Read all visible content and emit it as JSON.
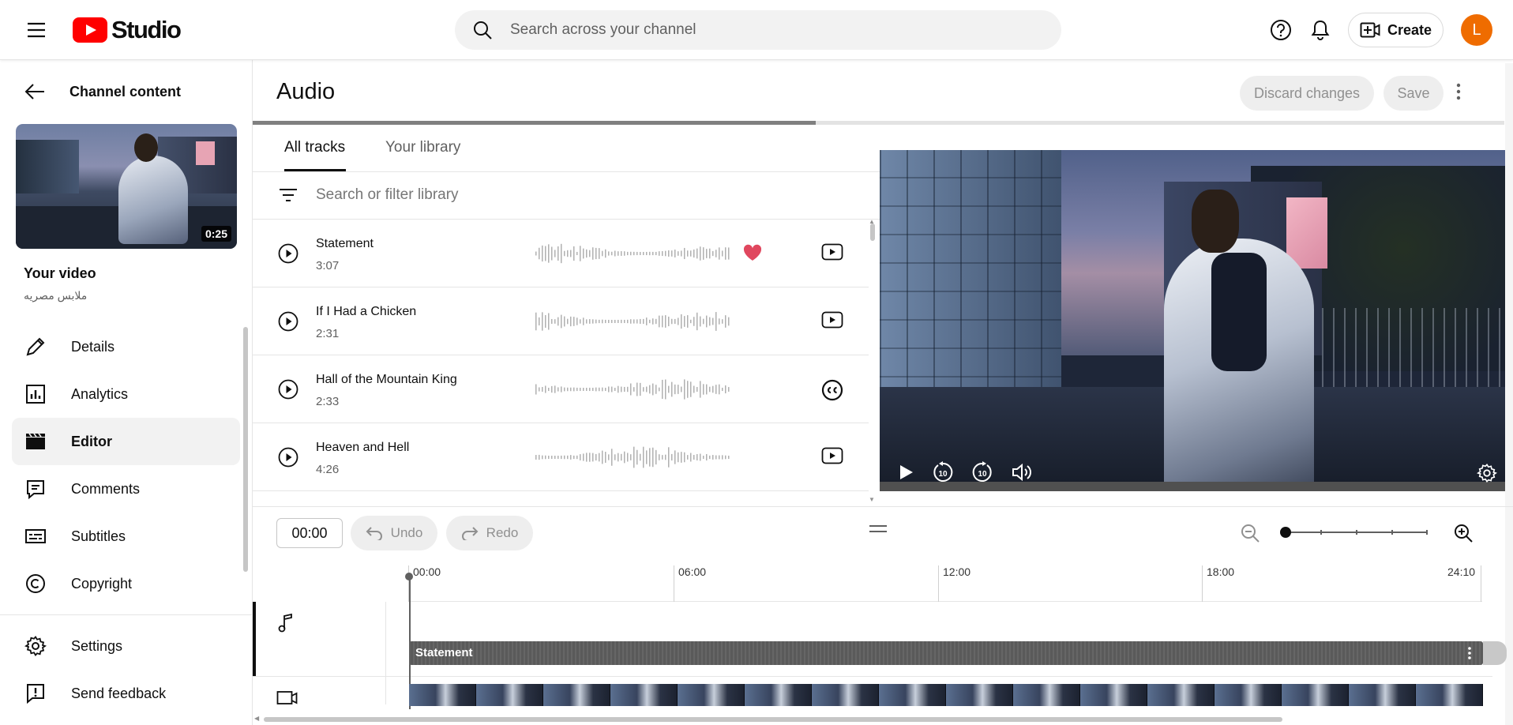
{
  "app": {
    "logo_text": "Studio",
    "brand_color": "#ff0000"
  },
  "search": {
    "placeholder": "Search across your channel"
  },
  "header": {
    "create_label": "Create",
    "avatar_initial": "L",
    "avatar_color": "#ef6c00"
  },
  "sidebar": {
    "back_label": "Channel content",
    "thumbnail_duration": "0:25",
    "your_video_label": "Your video",
    "video_title": "ملابس مصريه",
    "items": [
      {
        "label": "Details",
        "icon": "pencil-icon",
        "active": false
      },
      {
        "label": "Analytics",
        "icon": "analytics-icon",
        "active": false
      },
      {
        "label": "Editor",
        "icon": "clapperboard-icon",
        "active": true
      },
      {
        "label": "Comments",
        "icon": "comment-icon",
        "active": false
      },
      {
        "label": "Subtitles",
        "icon": "subtitles-icon",
        "active": false
      },
      {
        "label": "Copyright",
        "icon": "copyright-icon",
        "active": false
      }
    ],
    "bottom_items": [
      {
        "label": "Settings",
        "icon": "gear-icon"
      },
      {
        "label": "Send feedback",
        "icon": "feedback-icon"
      }
    ]
  },
  "page": {
    "title": "Audio",
    "discard_label": "Discard changes",
    "save_label": "Save",
    "progress": 0.45
  },
  "library": {
    "tabs": [
      {
        "label": "All tracks",
        "active": true
      },
      {
        "label": "Your library",
        "active": false
      }
    ],
    "filter_placeholder": "Search or filter library",
    "tracks": [
      {
        "name": "Statement",
        "duration": "3:07",
        "favorited": true,
        "badge": "youtube-icon"
      },
      {
        "name": "If I Had a Chicken",
        "duration": "2:31",
        "favorited": false,
        "badge": "youtube-icon"
      },
      {
        "name": "Hall of the Mountain King",
        "duration": "2:33",
        "favorited": false,
        "badge": "creative-commons-icon"
      },
      {
        "name": "Heaven and Hell",
        "duration": "4:26",
        "favorited": false,
        "badge": "youtube-icon"
      }
    ]
  },
  "timeline": {
    "current_time": "00:00",
    "undo_label": "Undo",
    "redo_label": "Redo",
    "ticks": [
      "00:00",
      "06:00",
      "12:00",
      "18:00",
      "24:10"
    ],
    "audio_clip_name": "Statement",
    "zoom_level": 0
  }
}
